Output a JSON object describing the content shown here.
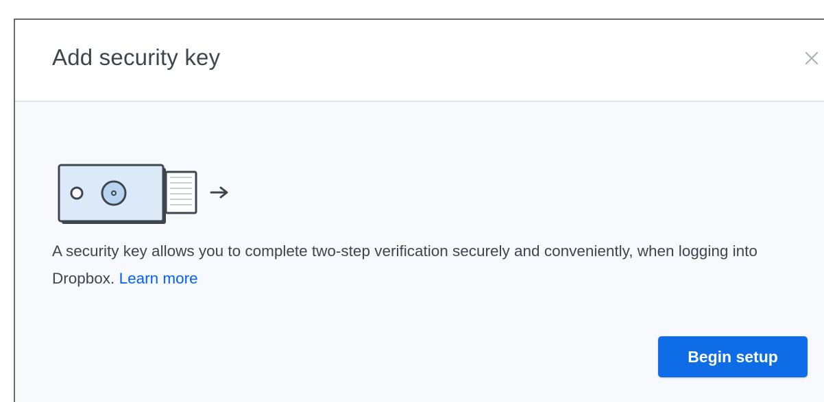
{
  "dialog": {
    "title": "Add security key",
    "close_icon": "close-icon",
    "illustration_icon": "security-key-icon",
    "description": "A security key allows you to complete two-step verification securely and conveniently, when logging into Dropbox.",
    "learn_more_label": "Learn more",
    "primary_button_label": "Begin setup"
  },
  "colors": {
    "accent": "#0d6ce6",
    "link": "#0061fe",
    "text": "#3d464d",
    "body_background": "#f7f9fc"
  }
}
